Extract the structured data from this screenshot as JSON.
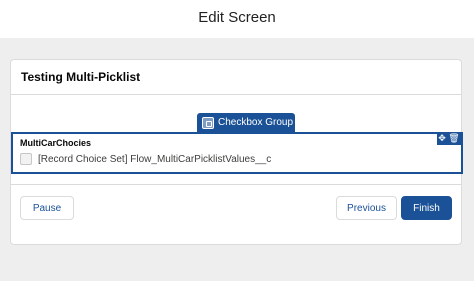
{
  "header": {
    "title": "Edit Screen"
  },
  "screen": {
    "title": "Testing Multi-Picklist",
    "component_tag": "Checkbox Group",
    "component": {
      "label": "MultiCarChocies",
      "option_label": "[Record Choice Set] Flow_MultiCarPicklistValues__c",
      "option_checked": false
    },
    "footer": {
      "pause_label": "Pause",
      "previous_label": "Previous",
      "finish_label": "Finish"
    }
  },
  "colors": {
    "brand": "#1b5297",
    "canvas_bg": "#eeeeee",
    "border": "#dddbda"
  },
  "icons": {
    "tag": "checkbox-group-icon",
    "move": "move-icon",
    "delete": "trash-icon"
  }
}
